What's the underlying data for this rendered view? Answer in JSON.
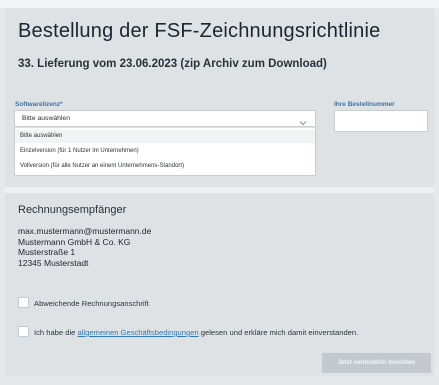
{
  "header": {
    "title": "Bestellung der FSF-Zeichnungsrichtlinie",
    "subtitle": "33. Lieferung vom 23.06.2023 (zip Archiv zum Download)"
  },
  "form": {
    "license_label": "Softwarelizenz*",
    "license_select": {
      "selected": "Bitte auswählen",
      "options": [
        "Bitte auswählen",
        "Einzelversion (für 1 Nutzer im Unternehmen)",
        "Vollversion (für alle Nutzer an einem Unternehmens-Standort)"
      ]
    },
    "order_number_label": "Ihre Bestellnummer"
  },
  "recipient": {
    "title": "Rechnungsempfänger",
    "lines": [
      "max.mustermann@mustermann.de",
      "Mustermann GmbH & Co. KG",
      "Musterstraße 1",
      "12345 Musterstadt"
    ]
  },
  "options": {
    "alt_address_label": "Abweichende Rechnungsanschrift",
    "terms_prefix": "Ich habe die ",
    "terms_link": "allgemeinen Geschäftsbedingungen",
    "terms_suffix": " gelesen und erkläre mich damit einverstanden."
  },
  "actions": {
    "submit_label": "Jetzt verbindlich bestellen"
  },
  "colors": {
    "background": "#e6e8eb",
    "card": "#dfe2e5",
    "label_blue": "#3c73a8",
    "link_blue": "#2f79b8",
    "button_disabled": "#c4c9ce"
  }
}
